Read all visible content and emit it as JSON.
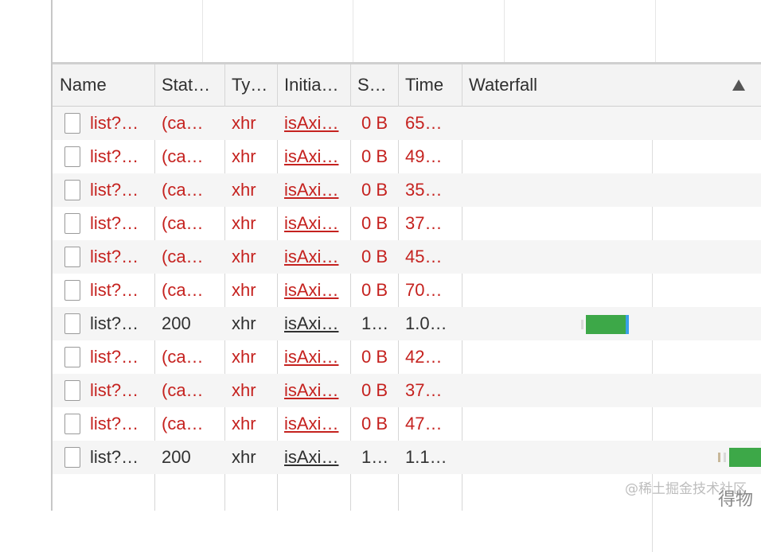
{
  "columns": {
    "name": "Name",
    "status": "Stat…",
    "type": "Ty…",
    "initiator": "Initia…",
    "size": "S…",
    "time": "Time",
    "waterfall": "Waterfall"
  },
  "rows": [
    {
      "name": "list?…",
      "status": "(ca…",
      "type": "xhr",
      "initiator": "isAxi…",
      "size": "0 B",
      "time": "65…",
      "state": "error"
    },
    {
      "name": "list?…",
      "status": "(ca…",
      "type": "xhr",
      "initiator": "isAxi…",
      "size": "0 B",
      "time": "49…",
      "state": "error"
    },
    {
      "name": "list?…",
      "status": "(ca…",
      "type": "xhr",
      "initiator": "isAxi…",
      "size": "0 B",
      "time": "35…",
      "state": "error"
    },
    {
      "name": "list?…",
      "status": "(ca…",
      "type": "xhr",
      "initiator": "isAxi…",
      "size": "0 B",
      "time": "37…",
      "state": "error"
    },
    {
      "name": "list?…",
      "status": "(ca…",
      "type": "xhr",
      "initiator": "isAxi…",
      "size": "0 B",
      "time": "45…",
      "state": "error"
    },
    {
      "name": "list?…",
      "status": "(ca…",
      "type": "xhr",
      "initiator": "isAxi…",
      "size": "0 B",
      "time": "70…",
      "state": "error"
    },
    {
      "name": "list?…",
      "status": "200",
      "type": "xhr",
      "initiator": "isAxi…",
      "size": "1…",
      "time": "1.0…",
      "state": "ok"
    },
    {
      "name": "list?…",
      "status": "(ca…",
      "type": "xhr",
      "initiator": "isAxi…",
      "size": "0 B",
      "time": "42…",
      "state": "error"
    },
    {
      "name": "list?…",
      "status": "(ca…",
      "type": "xhr",
      "initiator": "isAxi…",
      "size": "0 B",
      "time": "37…",
      "state": "error"
    },
    {
      "name": "list?…",
      "status": "(ca…",
      "type": "xhr",
      "initiator": "isAxi…",
      "size": "0 B",
      "time": "47…",
      "state": "error"
    },
    {
      "name": "list?…",
      "status": "200",
      "type": "xhr",
      "initiator": "isAxi…",
      "size": "1…",
      "time": "1.1…",
      "state": "ok"
    }
  ],
  "watermark": "@稀土掘金技术社区",
  "watermark_overlay": "得物",
  "colors": {
    "error": "#c5221f",
    "ok": "#303030",
    "receiving": "#3da848",
    "downloading": "#3aa0e8"
  }
}
